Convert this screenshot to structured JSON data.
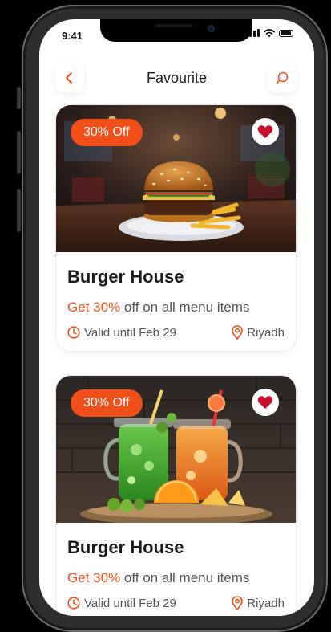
{
  "status_bar": {
    "time": "9:41"
  },
  "header": {
    "title": "Favourite"
  },
  "colors": {
    "accent": "#f04f1a",
    "heart": "#c8102e"
  },
  "offers": [
    {
      "badge": "30% Off",
      "title": "Burger House",
      "offer_highlight": "Get 30%",
      "offer_rest": " off on all menu items",
      "valid": "Valid until Feb 29",
      "location": "Riyadh",
      "image": "burger-photo"
    },
    {
      "badge": "30% Off",
      "title": "Burger House",
      "offer_highlight": "Get 30%",
      "offer_rest": " off on all menu items",
      "valid": "Valid until Feb 29",
      "location": "Riyadh",
      "image": "drinks-photo"
    }
  ]
}
